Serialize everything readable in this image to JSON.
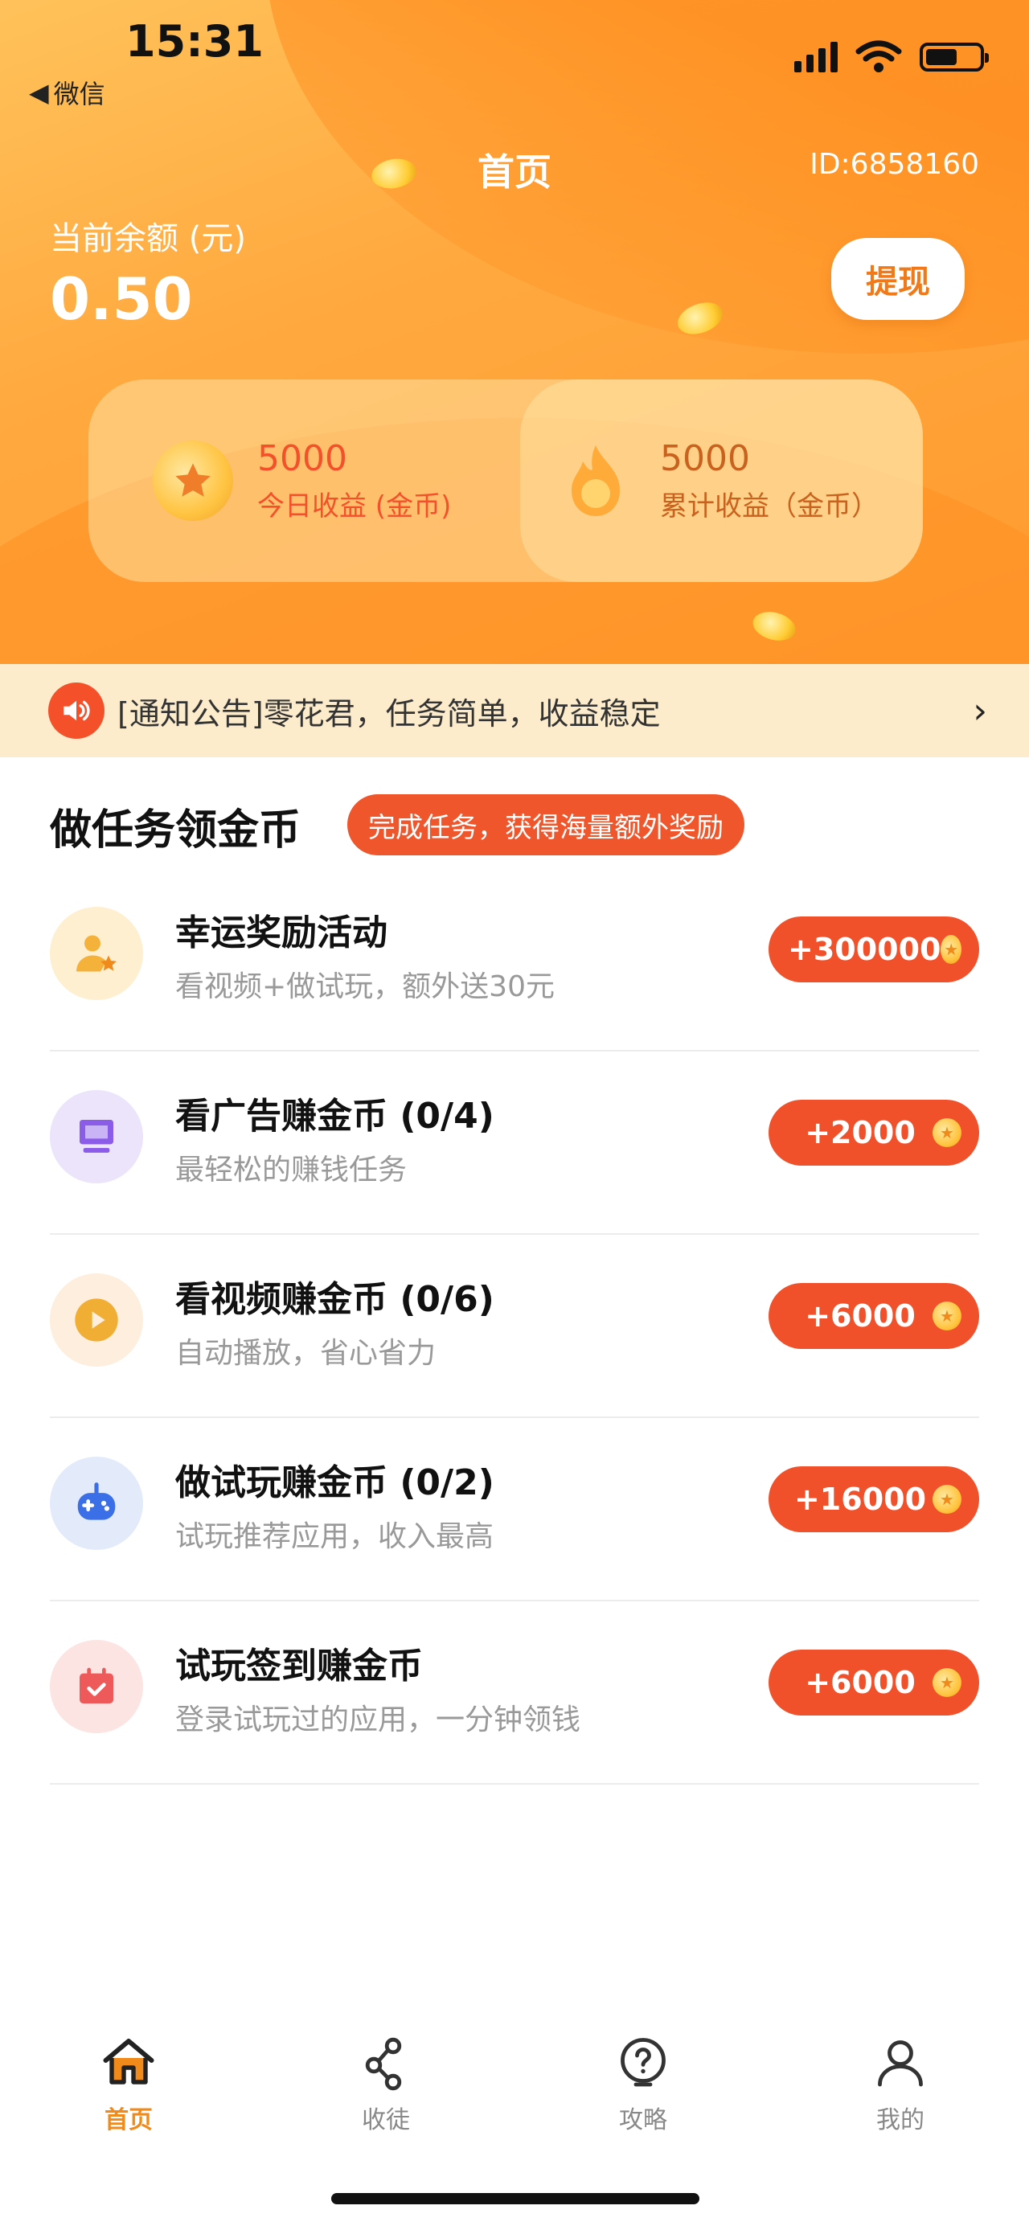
{
  "status_bar": {
    "time": "15:31",
    "back_app": "微信"
  },
  "header": {
    "title": "首页",
    "user_id": "ID:6858160",
    "balance_label": "当前余额 (元)",
    "balance_value": "0.50",
    "withdraw_label": "提现"
  },
  "stats": {
    "today": {
      "value": "5000",
      "label": "今日收益 (金币)"
    },
    "total": {
      "value": "5000",
      "label": "累计收益（金币）"
    }
  },
  "notice": {
    "text": "[通知公告]零花君，任务简单，收益稳定"
  },
  "tasks_section": {
    "title": "做任务领金币",
    "badge": "完成任务，获得海量额外奖励",
    "items": [
      {
        "title": "幸运奖励活动",
        "desc": "看视频+做试玩，额外送30元",
        "reward": "+300000",
        "icon": "user-star-icon",
        "color": "#f5b23b",
        "bg": "#fdefd0"
      },
      {
        "title": "看广告赚金币 (0/4)",
        "desc": "最轻松的赚钱任务",
        "reward": "+2000",
        "icon": "monitor-icon",
        "color": "#8a5ce8",
        "bg": "#ece4fb"
      },
      {
        "title": "看视频赚金币 (0/6)",
        "desc": "自动播放，省心省力",
        "reward": "+6000",
        "icon": "play-icon",
        "color": "#f0ae35",
        "bg": "#fdeedd"
      },
      {
        "title": "做试玩赚金币 (0/2)",
        "desc": "试玩推荐应用，收入最高",
        "reward": "+16000",
        "icon": "gamepad-icon",
        "color": "#3b6fe8",
        "bg": "#e3ebfb"
      },
      {
        "title": "试玩签到赚金币",
        "desc": "登录试玩过的应用，一分钟领钱",
        "reward": "+6000",
        "icon": "calendar-check-icon",
        "color": "#ee5a5a",
        "bg": "#fbe4e2"
      }
    ]
  },
  "tabbar": {
    "items": [
      {
        "label": "首页",
        "icon": "home-icon"
      },
      {
        "label": "收徒",
        "icon": "share-icon"
      },
      {
        "label": "攻略",
        "icon": "help-icon"
      },
      {
        "label": "我的",
        "icon": "profile-icon"
      }
    ]
  },
  "colors": {
    "accent": "#f0502a",
    "brand_orange": "#ffa93f",
    "active_tab": "#f08a1a"
  }
}
